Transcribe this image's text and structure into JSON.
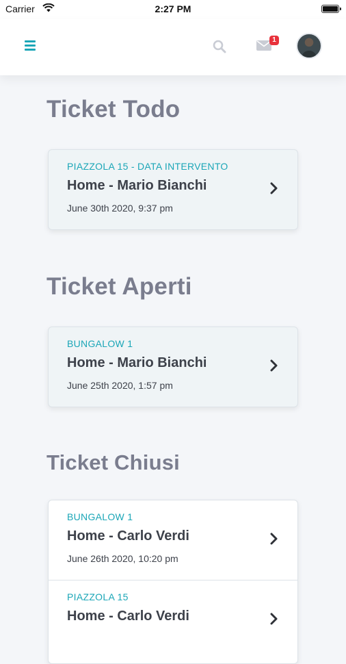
{
  "status_bar": {
    "carrier": "Carrier",
    "time": "2:27 PM"
  },
  "header": {
    "menu_icon": "hamburger-menu-icon",
    "search_icon": "search-icon",
    "mail_icon": "mail-icon",
    "mail_badge": "1",
    "accent_color": "#1aa6b7",
    "badge_color": "#e8323c"
  },
  "sections": [
    {
      "title": "Ticket Todo",
      "tickets": [
        {
          "location": "PIAZZOLA 15 - DATA INTERVENTO",
          "name": "Home - Mario Bianchi",
          "date": "June 30th 2020, 9:37 pm"
        }
      ]
    },
    {
      "title": "Ticket Aperti",
      "tickets": [
        {
          "location": "BUNGALOW 1",
          "name": "Home - Mario Bianchi",
          "date": "June 25th 2020, 1:57 pm"
        }
      ]
    },
    {
      "title": "Ticket Chiusi",
      "tickets": [
        {
          "location": "BUNGALOW 1",
          "name": "Home - Carlo Verdi",
          "date": "June 26th 2020, 10:20 pm"
        },
        {
          "location": "PIAZZOLA 15",
          "name": "Home - Carlo Verdi",
          "date": ""
        }
      ]
    }
  ]
}
